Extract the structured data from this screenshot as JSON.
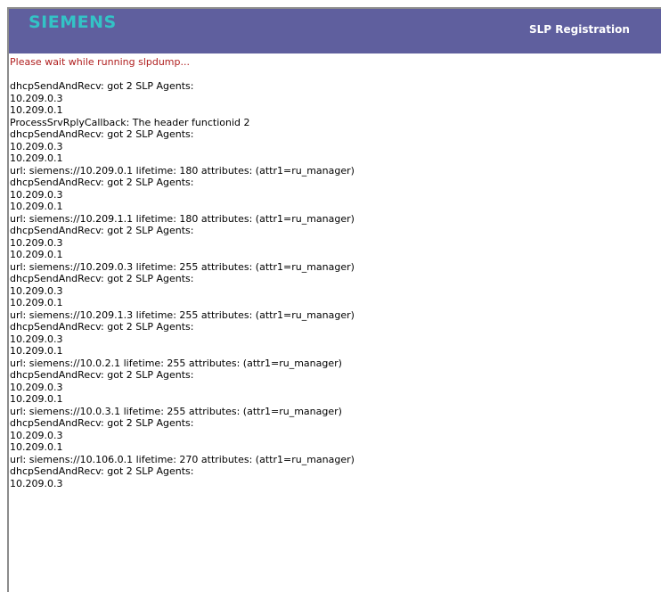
{
  "header": {
    "brand": "SIEMENS",
    "title": "SLP Registration"
  },
  "status_message": "Please wait while running slpdump...",
  "output_lines": [
    "dhcpSendAndRecv: got 2 SLP Agents:",
    "10.209.0.3",
    "10.209.0.1",
    "ProcessSrvRplyCallback: The header functionid 2",
    "dhcpSendAndRecv: got 2 SLP Agents:",
    "10.209.0.3",
    "10.209.0.1",
    "url: siemens://10.209.0.1 lifetime: 180 attributes: (attr1=ru_manager)",
    "dhcpSendAndRecv: got 2 SLP Agents:",
    "10.209.0.3",
    "10.209.0.1",
    "url: siemens://10.209.1.1 lifetime: 180 attributes: (attr1=ru_manager)",
    "dhcpSendAndRecv: got 2 SLP Agents:",
    "10.209.0.3",
    "10.209.0.1",
    "url: siemens://10.209.0.3 lifetime: 255 attributes: (attr1=ru_manager)",
    "dhcpSendAndRecv: got 2 SLP Agents:",
    "10.209.0.3",
    "10.209.0.1",
    "url: siemens://10.209.1.3 lifetime: 255 attributes: (attr1=ru_manager)",
    "dhcpSendAndRecv: got 2 SLP Agents:",
    "10.209.0.3",
    "10.209.0.1",
    "url: siemens://10.0.2.1 lifetime: 255 attributes: (attr1=ru_manager)",
    "dhcpSendAndRecv: got 2 SLP Agents:",
    "10.209.0.3",
    "10.209.0.1",
    "url: siemens://10.0.3.1 lifetime: 255 attributes: (attr1=ru_manager)",
    "dhcpSendAndRecv: got 2 SLP Agents:",
    "10.209.0.3",
    "10.209.0.1",
    "url: siemens://10.106.0.1 lifetime: 270 attributes: (attr1=ru_manager)",
    "dhcpSendAndRecv: got 2 SLP Agents:",
    "10.209.0.3"
  ],
  "colors": {
    "header_bg": "#5f5f9e",
    "brand": "#33c3c6",
    "title": "#ffffff",
    "status": "#b02020"
  }
}
